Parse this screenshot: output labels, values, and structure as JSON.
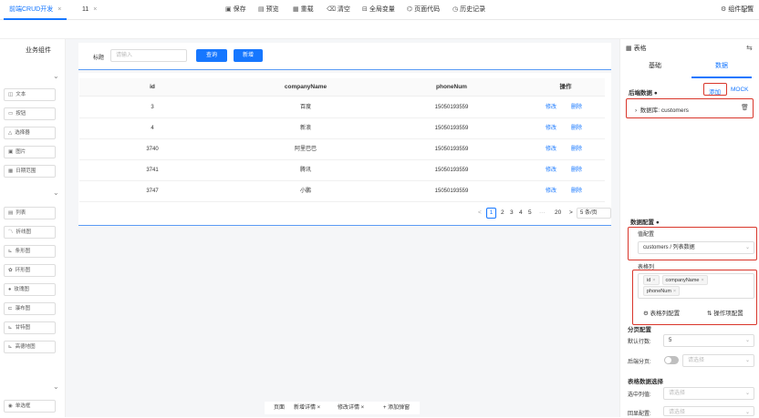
{
  "tabs": [
    {
      "label": "前端CRUD开发",
      "close": "×"
    },
    {
      "label": "11",
      "close": "×"
    }
  ],
  "toolbar": {
    "save": "保存",
    "preview": "预览",
    "reload": "重载",
    "clear": "清空",
    "global_vars": "全局变量",
    "page_code": "页面代码",
    "history": "历史记录",
    "component_config": "组件配置"
  },
  "left": {
    "title": "业务组件",
    "groups": [
      [
        "文本",
        "按钮",
        "选择器",
        "图片",
        "日期范围"
      ],
      [
        "列表",
        "折线图",
        "条形图",
        "环形图",
        "玫瑰图",
        "瀑布图",
        "甘特图",
        "高德地图"
      ],
      [
        "单选框"
      ]
    ]
  },
  "search": {
    "label": "标题",
    "placeholder": "请输入",
    "query": "查询",
    "add": "新增"
  },
  "table": {
    "headers": [
      "id",
      "companyName",
      "phoneNum",
      "操作"
    ],
    "rows": [
      {
        "id": "3",
        "companyName": "百度",
        "phoneNum": "15050193559"
      },
      {
        "id": "4",
        "companyName": "新浪",
        "phoneNum": "15050193559"
      },
      {
        "id": "3740",
        "companyName": "阿里巴巴",
        "phoneNum": "15050193559"
      },
      {
        "id": "3741",
        "companyName": "腾讯",
        "phoneNum": "15050193559"
      },
      {
        "id": "3747",
        "companyName": "小鹏",
        "phoneNum": "15050193559"
      }
    ],
    "edit": "修改",
    "delete": "删除"
  },
  "pager": {
    "prev": "<",
    "current": "1",
    "pages": [
      "2",
      "3",
      "4",
      "5"
    ],
    "ellipsis": "···",
    "last": "20",
    "next": ">",
    "size": "5 条/页"
  },
  "bottom_tabs": [
    "页面",
    "新增详情 ×",
    "修改详情 ×",
    "+ 添加弹窗"
  ],
  "right": {
    "component": "表格",
    "tab_basic": "基础",
    "tab_data": "数据",
    "backend_data": "后端数据",
    "add": "添加",
    "mock": "MOCK",
    "datasource": "数据库: customers",
    "data_config": "数据配置",
    "value_config": "值配置",
    "value_select": "customers / 列表数据",
    "table_columns": "表格列",
    "columns": [
      "id",
      "companyName",
      "phoneNum"
    ],
    "col_config": "表格列配置",
    "op_config": "操作项配置",
    "pagination": "分页配置",
    "default_rows_label": "默认行数:",
    "default_rows": "5",
    "backend_paging": "后端分页:",
    "please_select": "请选择",
    "table_select": "表格数据选择",
    "selected_value": "选中列值:",
    "echo_config": "回显配置:"
  },
  "colors": {
    "accent": "#1677ff",
    "highlight": "#d9362b"
  }
}
